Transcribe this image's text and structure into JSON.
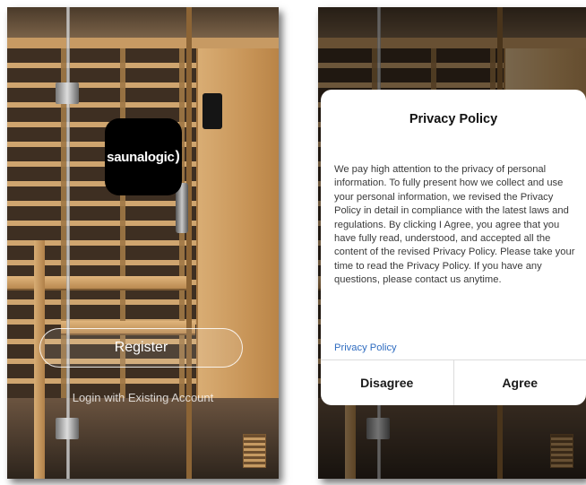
{
  "left_screen": {
    "logo_text": "saunalogic",
    "logo_mark": ")",
    "register_label": "Register",
    "login_label": "Login with Existing Account"
  },
  "right_screen": {
    "dialog": {
      "title": "Privacy Policy",
      "body": "We pay high attention to the privacy of personal information. To fully present how we collect and use your personal information, we revised the Privacy Policy in detail in compliance with the latest laws and regulations. By clicking I Agree, you agree that you have fully read, understood, and accepted all the content of the revised Privacy Policy. Please take your time to read the Privacy Policy. If you have any questions, please contact us anytime.",
      "link_label": "Privacy Policy",
      "disagree_label": "Disagree",
      "agree_label": "Agree"
    }
  },
  "colors": {
    "link": "#2f6cc0",
    "logo_bg": "#000000",
    "dialog_bg": "#ffffff"
  }
}
